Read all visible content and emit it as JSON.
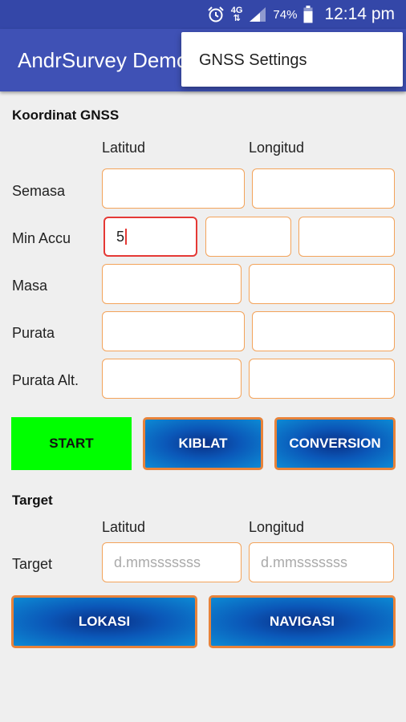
{
  "status": {
    "battery_pct": "74%",
    "time": "12:14 pm",
    "network": "4G",
    "alarm_icon": "alarm-icon",
    "signal_icon": "signal-icon",
    "battery_icon": "battery-icon"
  },
  "appbar": {
    "title": "AndrSurvey Demo"
  },
  "overflow_menu": {
    "items": [
      "GNSS Settings"
    ]
  },
  "gnss": {
    "section": "Koordinat GNSS",
    "col_latitud": "Latitud",
    "col_longitud": "Longitud",
    "rows": {
      "semasa": "Semasa",
      "min_accu": "Min Accu",
      "masa": "Masa",
      "purata": "Purata",
      "purata_alt": "Purata Alt."
    },
    "min_accu_value": "5"
  },
  "buttons": {
    "start": "START",
    "kiblat": "KIBLAT",
    "conversion": "CONVERSION",
    "lokasi": "LOKASI",
    "navigasi": "NAVIGASI"
  },
  "target": {
    "section": "Target",
    "col_latitud": "Latitud",
    "col_longitud": "Longitud",
    "row_label": "Target",
    "lat_placeholder": "d.mmsssssss",
    "lon_placeholder": "d.mmsssssss"
  },
  "colors": {
    "statusbar": "#3447a8",
    "appbar": "#3f51b5",
    "start": "#00ff00",
    "field_border": "#f3a35a",
    "focus_border": "#e53935"
  }
}
